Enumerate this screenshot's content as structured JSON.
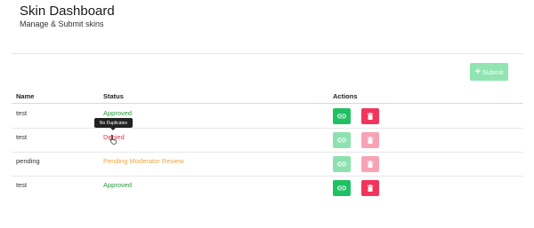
{
  "header": {
    "title": "Skin Dashboard",
    "subtitle": "Manage & Submit skins"
  },
  "toolbar": {
    "submit_label": "Submit",
    "submit_icon": "plus-icon"
  },
  "table": {
    "columns": [
      "Name",
      "Status",
      "Actions"
    ],
    "rows": [
      {
        "name": "test",
        "status": "Approved",
        "status_type": "approved",
        "actions_enabled": true
      },
      {
        "name": "test",
        "status": "Denied",
        "status_type": "denied",
        "actions_enabled": false
      },
      {
        "name": "pending",
        "status": "Pending Moderator Review",
        "status_type": "pending",
        "actions_enabled": false
      },
      {
        "name": "test",
        "status": "Approved",
        "status_type": "approved",
        "actions_enabled": true
      }
    ]
  },
  "tooltip": {
    "text": "No Duplicates"
  },
  "icons": {
    "link": "link-icon",
    "delete": "trash-icon"
  },
  "colors": {
    "success": "#20c163",
    "danger": "#f2355b",
    "approved_text": "#2a9a3c",
    "denied_text": "#e0354f",
    "pending_text": "#f0a640"
  }
}
